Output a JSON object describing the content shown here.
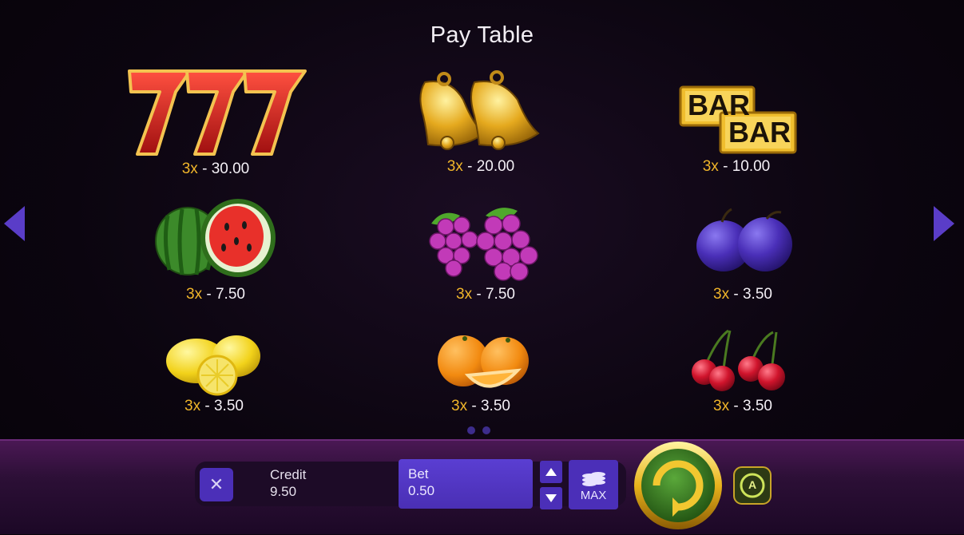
{
  "title": "Pay Table",
  "nav": {
    "prev": "prev-page",
    "next": "next-page"
  },
  "symbols": [
    {
      "name": "sevens",
      "multiplier": "3x",
      "payout": " - 30.00"
    },
    {
      "name": "bells",
      "multiplier": "3x",
      "payout": " - 20.00"
    },
    {
      "name": "bar",
      "multiplier": "3x",
      "payout": " - 10.00",
      "bar_text": "BAR"
    },
    {
      "name": "watermelon",
      "multiplier": "3x",
      "payout": " - 7.50"
    },
    {
      "name": "grapes",
      "multiplier": "3x",
      "payout": " - 7.50"
    },
    {
      "name": "plums",
      "multiplier": "3x",
      "payout": " - 3.50"
    },
    {
      "name": "lemons",
      "multiplier": "3x",
      "payout": " - 3.50"
    },
    {
      "name": "oranges",
      "multiplier": "3x",
      "payout": " - 3.50"
    },
    {
      "name": "cherries",
      "multiplier": "3x",
      "payout": " - 3.50"
    }
  ],
  "pagination": {
    "pages": 2,
    "current": 1
  },
  "bottom": {
    "close_icon": "✕",
    "credit_label": "Credit",
    "credit_value": "9.50",
    "bet_label": "Bet",
    "bet_value": "0.50",
    "max_label": "MAX",
    "auto_label": "A"
  },
  "colors": {
    "accent": "#4b2fb8",
    "multiplier": "#f0b52a",
    "bar": "#2c0f36"
  }
}
